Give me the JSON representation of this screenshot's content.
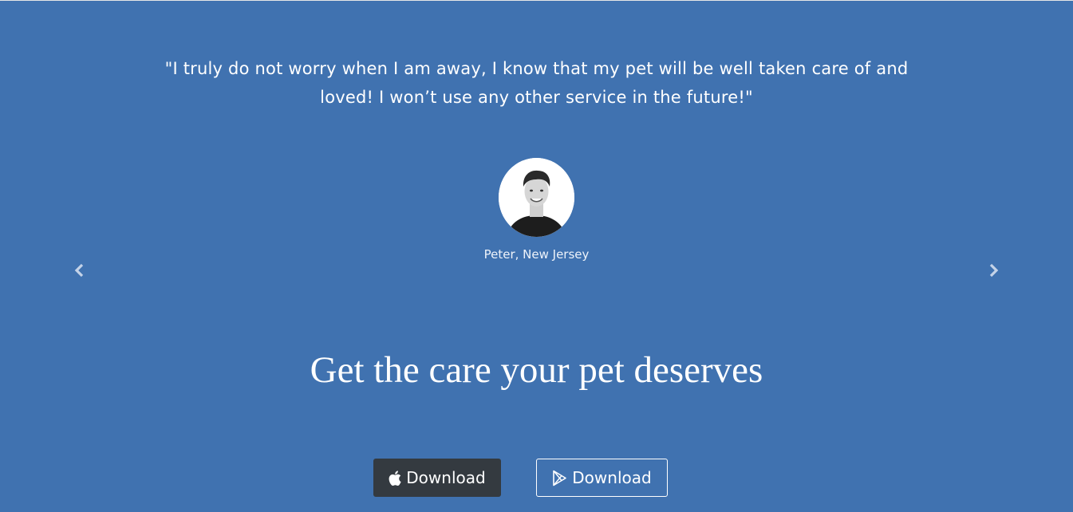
{
  "testimonial": {
    "quote": "\"I truly do not worry when I am away, I know that my pet will be well taken care of and loved! I won’t use any other service in the future!\"",
    "author": "Peter, New Jersey",
    "prev_icon": "chevron-left-icon",
    "next_icon": "chevron-right-icon"
  },
  "cta": {
    "headline": "Get the care your pet deserves",
    "apple_button_label": "Download",
    "apple_icon": "apple-icon",
    "google_button_label": "Download",
    "google_icon": "google-play-icon"
  },
  "colors": {
    "background": "#4072b0",
    "apple_button_bg": "#343a40",
    "text": "#ffffff"
  }
}
